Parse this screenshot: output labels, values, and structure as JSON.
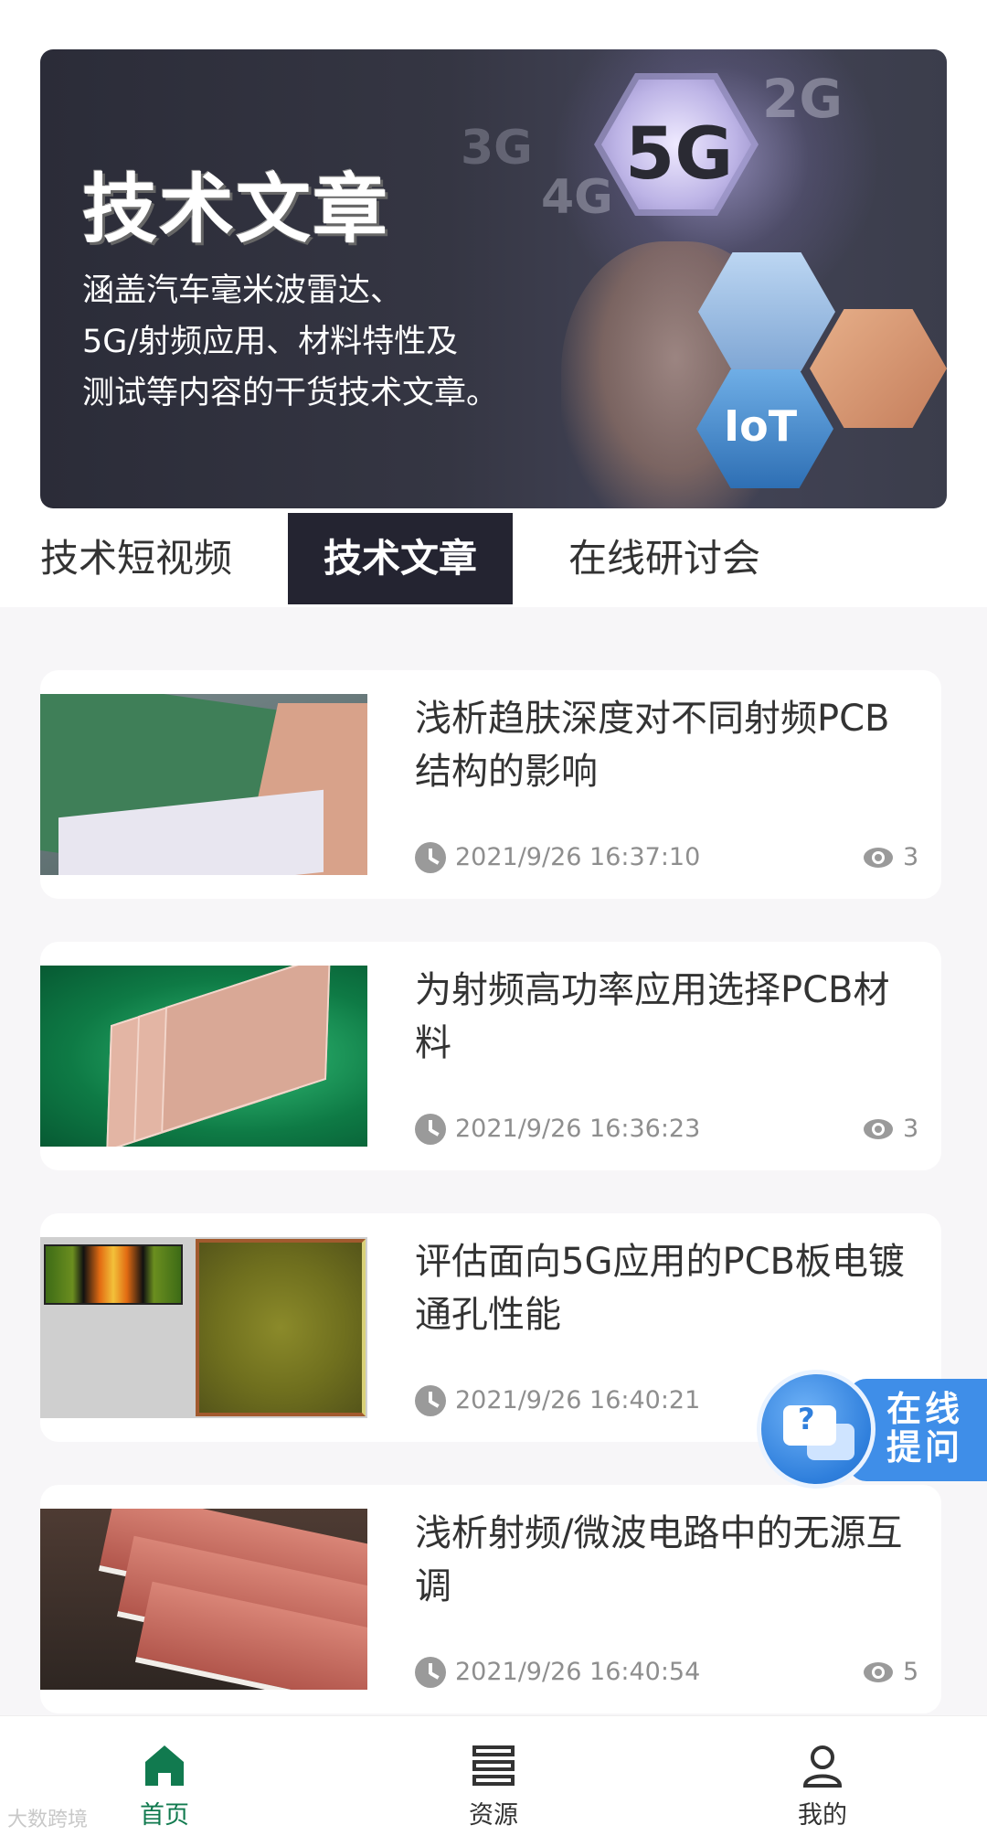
{
  "banner": {
    "title": "技术文章",
    "desc_lines": [
      "涵盖汽车毫米波雷达、",
      "5G/射频应用、材料特性及",
      "测试等内容的干货技术文章。"
    ],
    "hex_labels": {
      "g5": "5G",
      "g2": "2G",
      "g3": "3G",
      "g4": "4G",
      "iot": "IoT"
    }
  },
  "tabs": [
    {
      "label": "技术短视频",
      "active": false
    },
    {
      "label": "技术文章",
      "active": true
    },
    {
      "label": "在线研讨会",
      "active": false
    }
  ],
  "articles": [
    {
      "title": "浅析趋肤深度对不同射频PCB结构的影响",
      "time": "2021/9/26 16:37:10",
      "views": "3"
    },
    {
      "title": "为射频高功率应用选择PCB材料",
      "time": "2021/9/26 16:36:23",
      "views": "3"
    },
    {
      "title": "评估面向5G应用的PCB板电镀通孔性能",
      "time": "2021/9/26 16:40:21",
      "views": ""
    },
    {
      "title": "浅析射频/微波电路中的无源互调",
      "time": "2021/9/26 16:40:54",
      "views": "5"
    }
  ],
  "help_float": {
    "label": "在线提问",
    "icon": "question-chat-icon"
  },
  "bottom_nav": [
    {
      "label": "首页",
      "icon": "home-icon",
      "active": true
    },
    {
      "label": "资源",
      "icon": "list-icon",
      "active": false
    },
    {
      "label": "我的",
      "icon": "user-icon",
      "active": false
    }
  ],
  "watermark": "大数跨境",
  "colors": {
    "active_tab_bg": "#242431",
    "accent_green": "#117a4f",
    "help_blue": "#3f8ee8"
  }
}
